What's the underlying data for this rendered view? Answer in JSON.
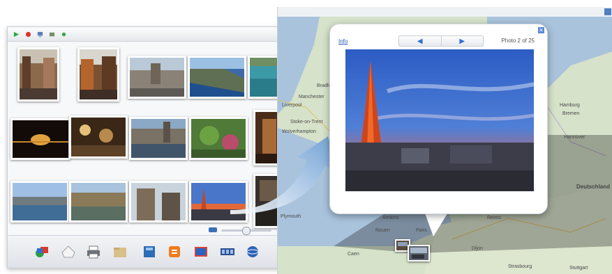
{
  "map": {
    "places": [
      "Bradford",
      "Manchester",
      "Liverpool",
      "Stoke-on-Trent",
      "Wolverhampton",
      "Hamburg",
      "Bremen",
      "Hannover",
      "Deutschland",
      "Plymouth",
      "Caen",
      "Paris",
      "Dijon",
      "Strasbourg",
      "Stuttgart",
      "Rouen",
      "Reims",
      "Amiens"
    ]
  },
  "popup": {
    "info_link": "Info",
    "counter": "Photo 2 of 25",
    "prev": "◀",
    "next": "▶",
    "close": "✕"
  }
}
